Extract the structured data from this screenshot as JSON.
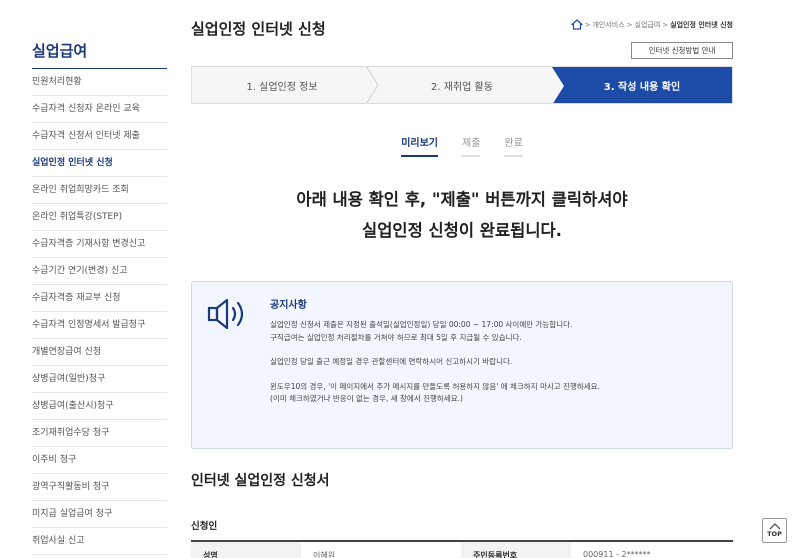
{
  "sidebar": {
    "title": "실업급여",
    "items": [
      {
        "label": "민원처리현황"
      },
      {
        "label": "수급자격 신청자 온라인 교육"
      },
      {
        "label": "수급자격 신청서 인터넷 제출"
      },
      {
        "label": "실업인정 인터넷 신청",
        "active": true
      },
      {
        "label": "온라인 취업희망카드 조회"
      },
      {
        "label": "온라인 취업특강(STEP)"
      },
      {
        "label": "수급자격증 기재사항 변경신고"
      },
      {
        "label": "수급기간 연기(변경) 신고"
      },
      {
        "label": "수급자격증 재교부 신청"
      },
      {
        "label": "수급자격 인정명세서 발급청구"
      },
      {
        "label": "개별연장급여 신청"
      },
      {
        "label": "상병급여(일반)청구"
      },
      {
        "label": "상병급여(출산시)청구"
      },
      {
        "label": "조기재취업수당 청구"
      },
      {
        "label": "이주비 청구"
      },
      {
        "label": "광역구직활동비 청구"
      },
      {
        "label": "미지급 실업급여 청구"
      },
      {
        "label": "취업사실 신고"
      }
    ]
  },
  "header": {
    "title": "실업인정 인터넷 신청",
    "breadcrumb": [
      "개인서비스",
      "실업급여",
      "실업인정 인터넷 신청"
    ],
    "breadcrumb_sep": ">",
    "guide_button": "인터넷 신청방법 안내"
  },
  "steps": [
    {
      "label": "1. 실업인정 정보"
    },
    {
      "label": "2. 재취업 활동"
    },
    {
      "label": "3. 작성 내용 확인",
      "active": true
    }
  ],
  "subtabs": [
    {
      "label": "미리보기",
      "active": true
    },
    {
      "label": "제출"
    },
    {
      "label": "완료"
    }
  ],
  "headline": {
    "line1": "아래 내용 확인 후, \"제출\" 버튼까지 클릭하셔야",
    "line2": "실업인정 신청이 완료됩니다."
  },
  "notice": {
    "icon": "speaker-icon",
    "title": "공지사항",
    "paragraphs": [
      [
        "실업인정 신청서 제출은 지정된 출석일(실업인정일) 당일 00:00 ~ 17:00 사이에만 가능합니다.",
        "구직급여는 실업인정 처리절차를 거쳐야 하므로 최대 5일 후 지급될 수 있습니다."
      ],
      [
        "실업인정 당일 출근 예정일 경우 관할센터에 연락하시어 신고하시기 바랍니다."
      ],
      [
        "윈도우10의 경우, '이 페이지에서 추가 메시지를 만들도록 허용하지 않음' 에 체크하지 마시고 진행하세요.",
        "(이미 체크하였거나 반응이 없는 경우, 새 창에서 진행하세요.)"
      ]
    ]
  },
  "form": {
    "section_title": "인터넷 실업인정 신청서",
    "subsection_title": "신청인",
    "row": {
      "name_label": "성명",
      "name_value": "이혜원",
      "rrn_label": "주민등록번호",
      "rrn_value": "000911 - 2******"
    }
  },
  "top_button": {
    "label": "TOP"
  },
  "colors": {
    "brand": "#1b3a7a",
    "active_step": "#1c4ca8",
    "notice_bg": "#f2f7fd"
  }
}
